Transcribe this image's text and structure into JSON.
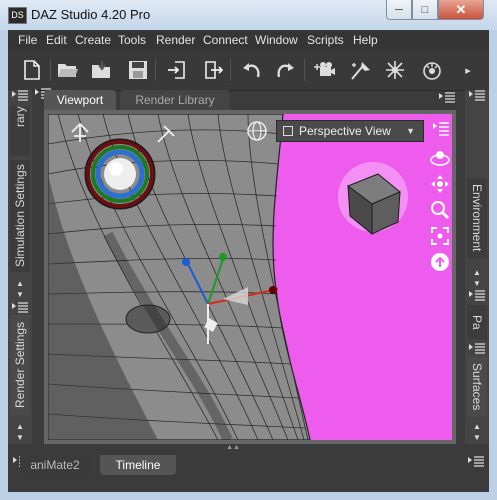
{
  "window": {
    "title": "DAZ Studio 4.20 Pro",
    "app_icon_text": "DS",
    "minimize_glyph": "─",
    "maximize_glyph": "□",
    "close_glyph": "✕"
  },
  "menu": [
    "File",
    "Edit",
    "Create",
    "Tools",
    "Render",
    "Connect",
    "Window",
    "Scripts",
    "Help"
  ],
  "toolbar": {
    "icons": [
      "new-file-icon",
      "open-file-icon",
      "merge-file-icon",
      "save-icon",
      "import-icon",
      "export-icon",
      "undo-icon",
      "redo-icon",
      "render-settings-icon",
      "spotlight-icon",
      "distant-light-icon",
      "point-light-icon"
    ],
    "overflow_glyph": "▸"
  },
  "left_panel": {
    "tabs": [
      "Library",
      "Simulation Settings",
      "Render Settings"
    ],
    "library_visible_text": "rary"
  },
  "right_panel": {
    "tabs": [
      "Environment",
      "Pa",
      "Surfaces"
    ]
  },
  "viewport_tabs": {
    "items": [
      "Viewport",
      "Render Library"
    ],
    "active": "Viewport"
  },
  "viewport": {
    "view_select": "Perspective View",
    "background_color": "#ee5cee"
  },
  "bottom_tabs": {
    "items": [
      "aniMate2",
      "Timeline"
    ],
    "active": "Timeline"
  },
  "colors": {
    "panel_bg": "#3b3b3b",
    "accent_highlight": "#bcd0e6"
  }
}
